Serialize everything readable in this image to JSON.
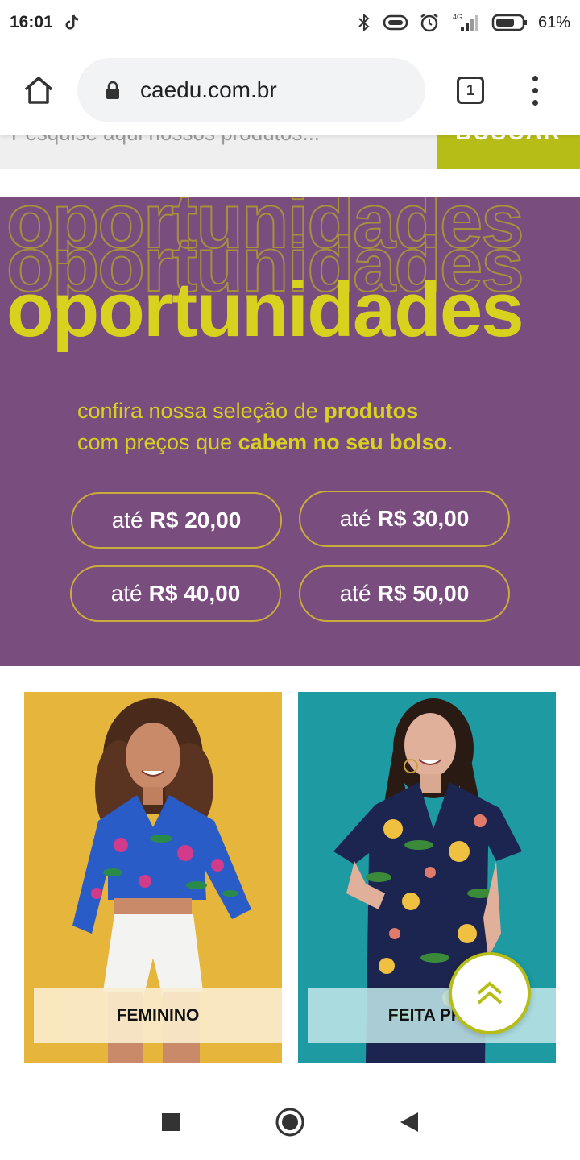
{
  "status_bar": {
    "time": "16:01",
    "battery_pct": "61%",
    "network": "4G",
    "icons": [
      "tiktok-icon",
      "bluetooth-icon",
      "vibrate-icon",
      "alarm-icon",
      "signal-icon",
      "battery-icon"
    ]
  },
  "browser": {
    "url": "caedu.com.br",
    "tab_count": "1",
    "icons": [
      "home-icon",
      "lock-icon",
      "tabs-icon",
      "more-vert-icon"
    ]
  },
  "search": {
    "placeholder": "Pesquise aqui nossos produtos...",
    "button_label": "BUSCAR"
  },
  "banner": {
    "ghost_word": "oportunidades",
    "headline": "oportunidades",
    "line1_prefix": "confira nossa seleção de ",
    "line1_bold": "produtos",
    "line2_prefix": "com preços que ",
    "line2_bold": "cabem no seu bolso",
    "line2_suffix": ".",
    "price_buttons": [
      {
        "prefix": "até",
        "value": "R$ 20,00"
      },
      {
        "prefix": "até",
        "value": "R$ 30,00"
      },
      {
        "prefix": "até",
        "value": "R$ 40,00"
      },
      {
        "prefix": "até",
        "value": "R$ 50,00"
      }
    ],
    "colors": {
      "background": "#7a4d7f",
      "accent": "#d8d21f",
      "button_border": "#c8ad3a"
    }
  },
  "categories": [
    {
      "label": "FEMININO",
      "bg": "#e6b53c"
    },
    {
      "label": "FEITA PRA",
      "bg": "#1e9aa2"
    }
  ],
  "back_to_top": {
    "icon": "double-chevron-up-icon"
  },
  "nav_bar": {
    "icons": [
      "recents-square-icon",
      "home-circle-icon",
      "back-triangle-icon"
    ]
  }
}
